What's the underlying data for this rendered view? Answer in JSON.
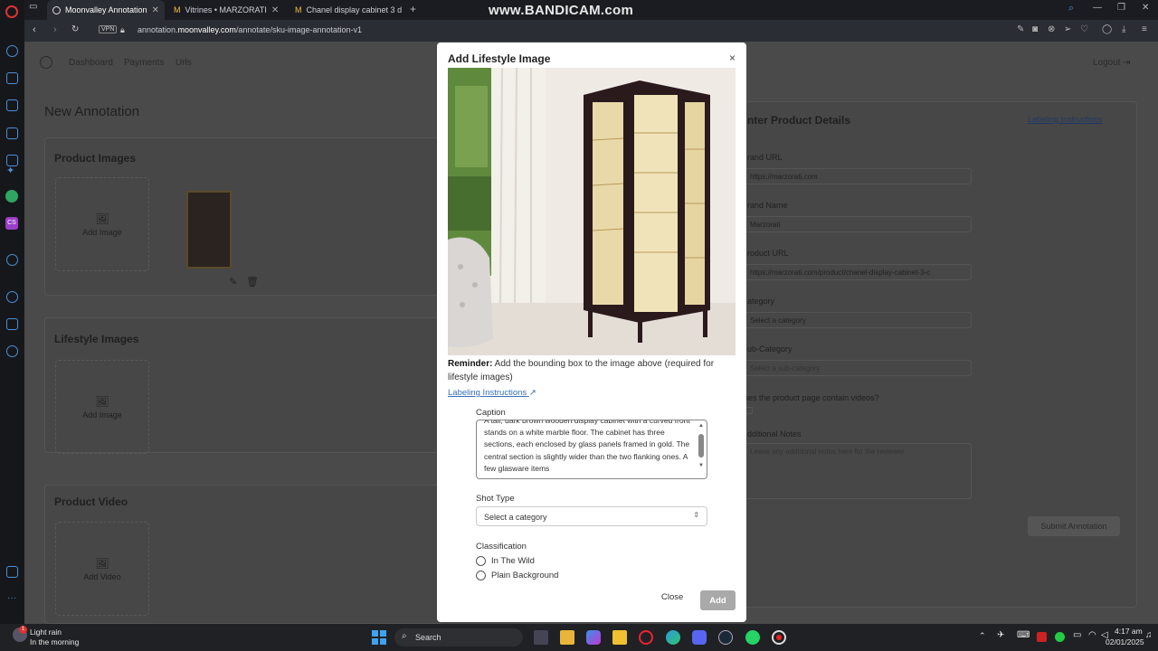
{
  "browser": {
    "tabs": [
      {
        "label": "Moonvalley Annotation",
        "active": true
      },
      {
        "label": "Vitrines • MARZORATI",
        "active": false
      },
      {
        "label": "Chanel display cabinet 3 d",
        "active": false
      }
    ],
    "watermark": "www.BANDICAM.com",
    "vpn_label": "VPN",
    "url_prefix": "annotation.",
    "url_domain": "moonvalley.com",
    "url_path": "/annotate/sku-image-annotation-v1"
  },
  "page": {
    "nav": [
      "Dashboard",
      "Payments",
      "Urls"
    ],
    "logout": "Logout",
    "title": "New Annotation",
    "product_images_title": "Product Images",
    "add_image": "Add Image",
    "lifestyle_images_title": "Lifestyle Images",
    "add_image_2": "Add Image",
    "product_video_title": "Product Video",
    "add_video": "Add Video",
    "details_title": "nter Product Details",
    "labeling_instructions": "Labeling Instructions",
    "brand_url_label": "rand URL",
    "brand_url_value": "https://marzorati.com",
    "brand_name_label": "rand Name",
    "brand_name_value": "Marzorati",
    "product_url_label": "roduct URL",
    "product_url_value": "https://marzorati.com/product/chanel-display-cabinet-3-c",
    "category_label": "ategory",
    "category_value": "Select a category",
    "subcategory_label": "ub-Category",
    "subcategory_value": "Select a sub-category",
    "videos_question": "oes the product page contain videos?",
    "notes_label": "dditional Notes",
    "notes_placeholder": "Leave any additional notes here for the reviewer",
    "submit": "Submit Annotation"
  },
  "modal": {
    "title": "Add Lifestyle Image",
    "close_symbol": "×",
    "reminder_bold": "Reminder:",
    "reminder_text": " Add the bounding box to the image above (required for lifestyle images)",
    "labeling_link": "Labeling Instructions",
    "caption_label": "Caption",
    "caption_text": "A tall, dark brown wooden display cabinet with a curved front stands on a white marble floor. The cabinet has three sections, each enclosed by glass panels framed in gold. The central section is slightly wider than the two flanking ones. A few glasware items",
    "shot_type_label": "Shot Type",
    "shot_type_value": "Select a category",
    "classification_label": "Classification",
    "option_wild": "In The Wild",
    "option_plain": "Plain Background",
    "close_button": "Close",
    "add_button": "Add"
  },
  "taskbar": {
    "weather_line1": "Light rain",
    "weather_line2": "In the morning",
    "notification_count": "1",
    "search_label": "Search",
    "time": "4:17 am",
    "date": "02/01/2025"
  },
  "colors": {
    "accent_link": "#3a6fb5",
    "add_button_disabled": "#a9a9a9",
    "sidebar_icon": "#4c8fd6"
  }
}
